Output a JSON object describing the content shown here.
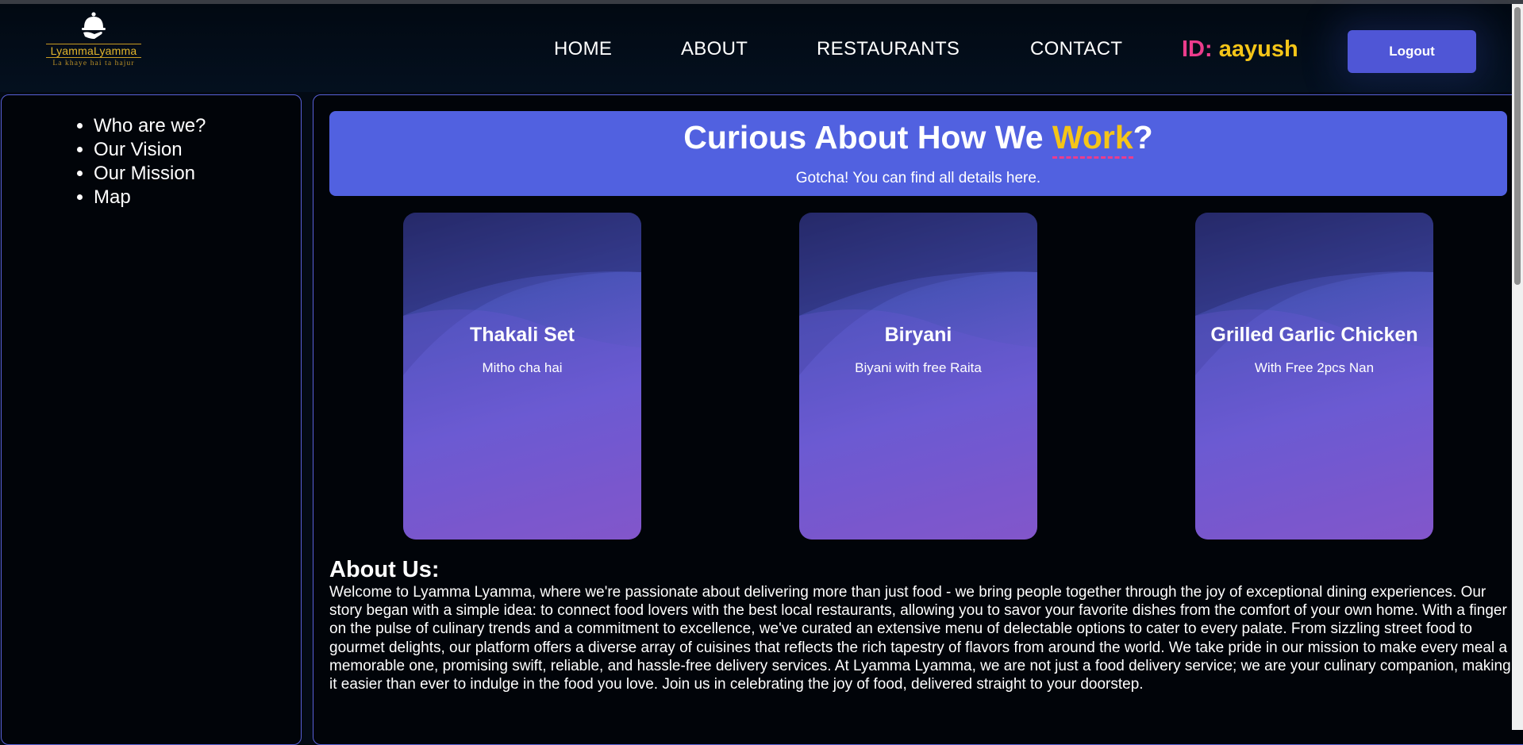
{
  "brand": {
    "name": "LyammaLyamma",
    "tagline": "La khaye hai ta hajur",
    "logo_icon": "cloche-with-hand-icon",
    "accent_color": "#e3b52c"
  },
  "nav": {
    "items": [
      "HOME",
      "ABOUT",
      "RESTAURANTS",
      "CONTACT"
    ]
  },
  "user": {
    "label": "ID:",
    "username": "aayush",
    "label_color": "#ec3c8c",
    "username_color": "#f5c518"
  },
  "logout_label": "Logout",
  "sidebar": {
    "items": [
      "Who are we?",
      "Our Vision",
      "Our Mission",
      "Map"
    ]
  },
  "hero": {
    "title_prefix": "Curious About How We ",
    "title_highlight": "Work",
    "title_suffix": "?",
    "subtitle": "Gotcha! You can find all details here.",
    "background_color": "#5161e0"
  },
  "cards": [
    {
      "title": "Thakali Set",
      "subtitle": "Mitho cha hai"
    },
    {
      "title": "Biryani",
      "subtitle": "Biyani with free Raita"
    },
    {
      "title": "Grilled Garlic Chicken",
      "subtitle": "With Free 2pcs Nan"
    }
  ],
  "about": {
    "title": "About Us:",
    "text": "Welcome to Lyamma Lyamma, where we're passionate about delivering more than just food - we bring people together through the joy of exceptional dining experiences. Our story began with a simple idea: to connect food lovers with the best local restaurants, allowing you to savor your favorite dishes from the comfort of your own home. With a finger on the pulse of culinary trends and a commitment to excellence, we've curated an extensive menu of delectable options to cater to every palate. From sizzling street food to gourmet delights, our platform offers a diverse array of cuisines that reflects the rich tapestry of flavors from around the world. We take pride in our mission to make every meal a memorable one, promising swift, reliable, and hassle-free delivery services. At Lyamma Lyamma, we are not just a food delivery service; we are your culinary companion, making it easier than ever to indulge in the food you love. Join us in celebrating the joy of food, delivered straight to your doorstep."
  }
}
